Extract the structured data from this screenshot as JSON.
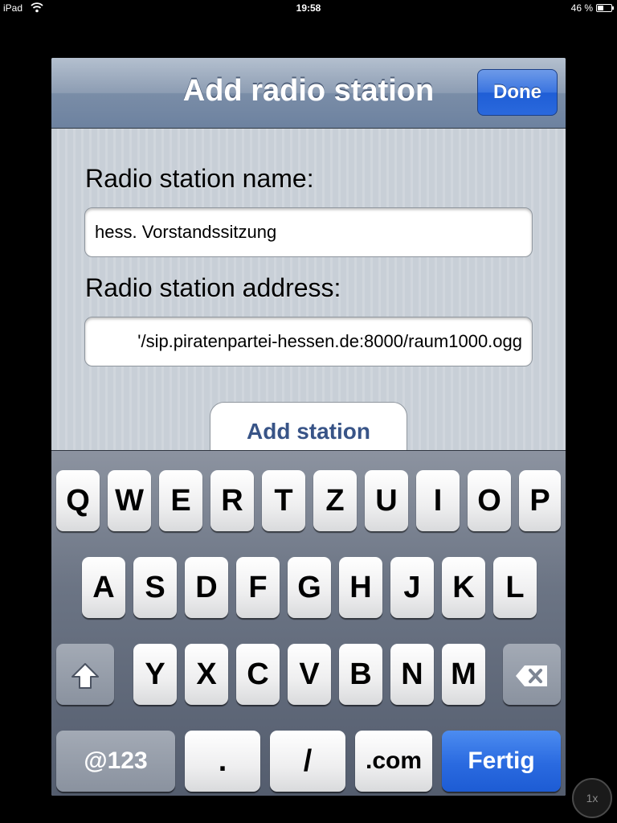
{
  "status_bar": {
    "carrier": "iPad",
    "time": "19:58",
    "battery": "46 %",
    "battery_level": 0.46
  },
  "navbar": {
    "title": "Add radio station",
    "done_label": "Done"
  },
  "form": {
    "name_label": "Radio station name:",
    "name_value": "hess. Vorstandssitzung",
    "address_label": "Radio station address:",
    "address_value": "'/sip.piratenpartei-hessen.de:8000/raum1000.ogg",
    "add_button_label": "Add station"
  },
  "keyboard": {
    "row1": [
      "Q",
      "W",
      "E",
      "R",
      "T",
      "Z",
      "U",
      "I",
      "O",
      "P"
    ],
    "row2": [
      "A",
      "S",
      "D",
      "F",
      "G",
      "H",
      "J",
      "K",
      "L"
    ],
    "row3": [
      "Y",
      "X",
      "C",
      "V",
      "B",
      "N",
      "M"
    ],
    "shift_icon": "shift-arrow-icon",
    "delete_icon": "backspace-icon",
    "numbers_label": "@123",
    "dot_label": ".",
    "slash_label": "/",
    "dotcom_label": ".com",
    "return_label": "Fertig"
  },
  "zoom_badge": "1x"
}
